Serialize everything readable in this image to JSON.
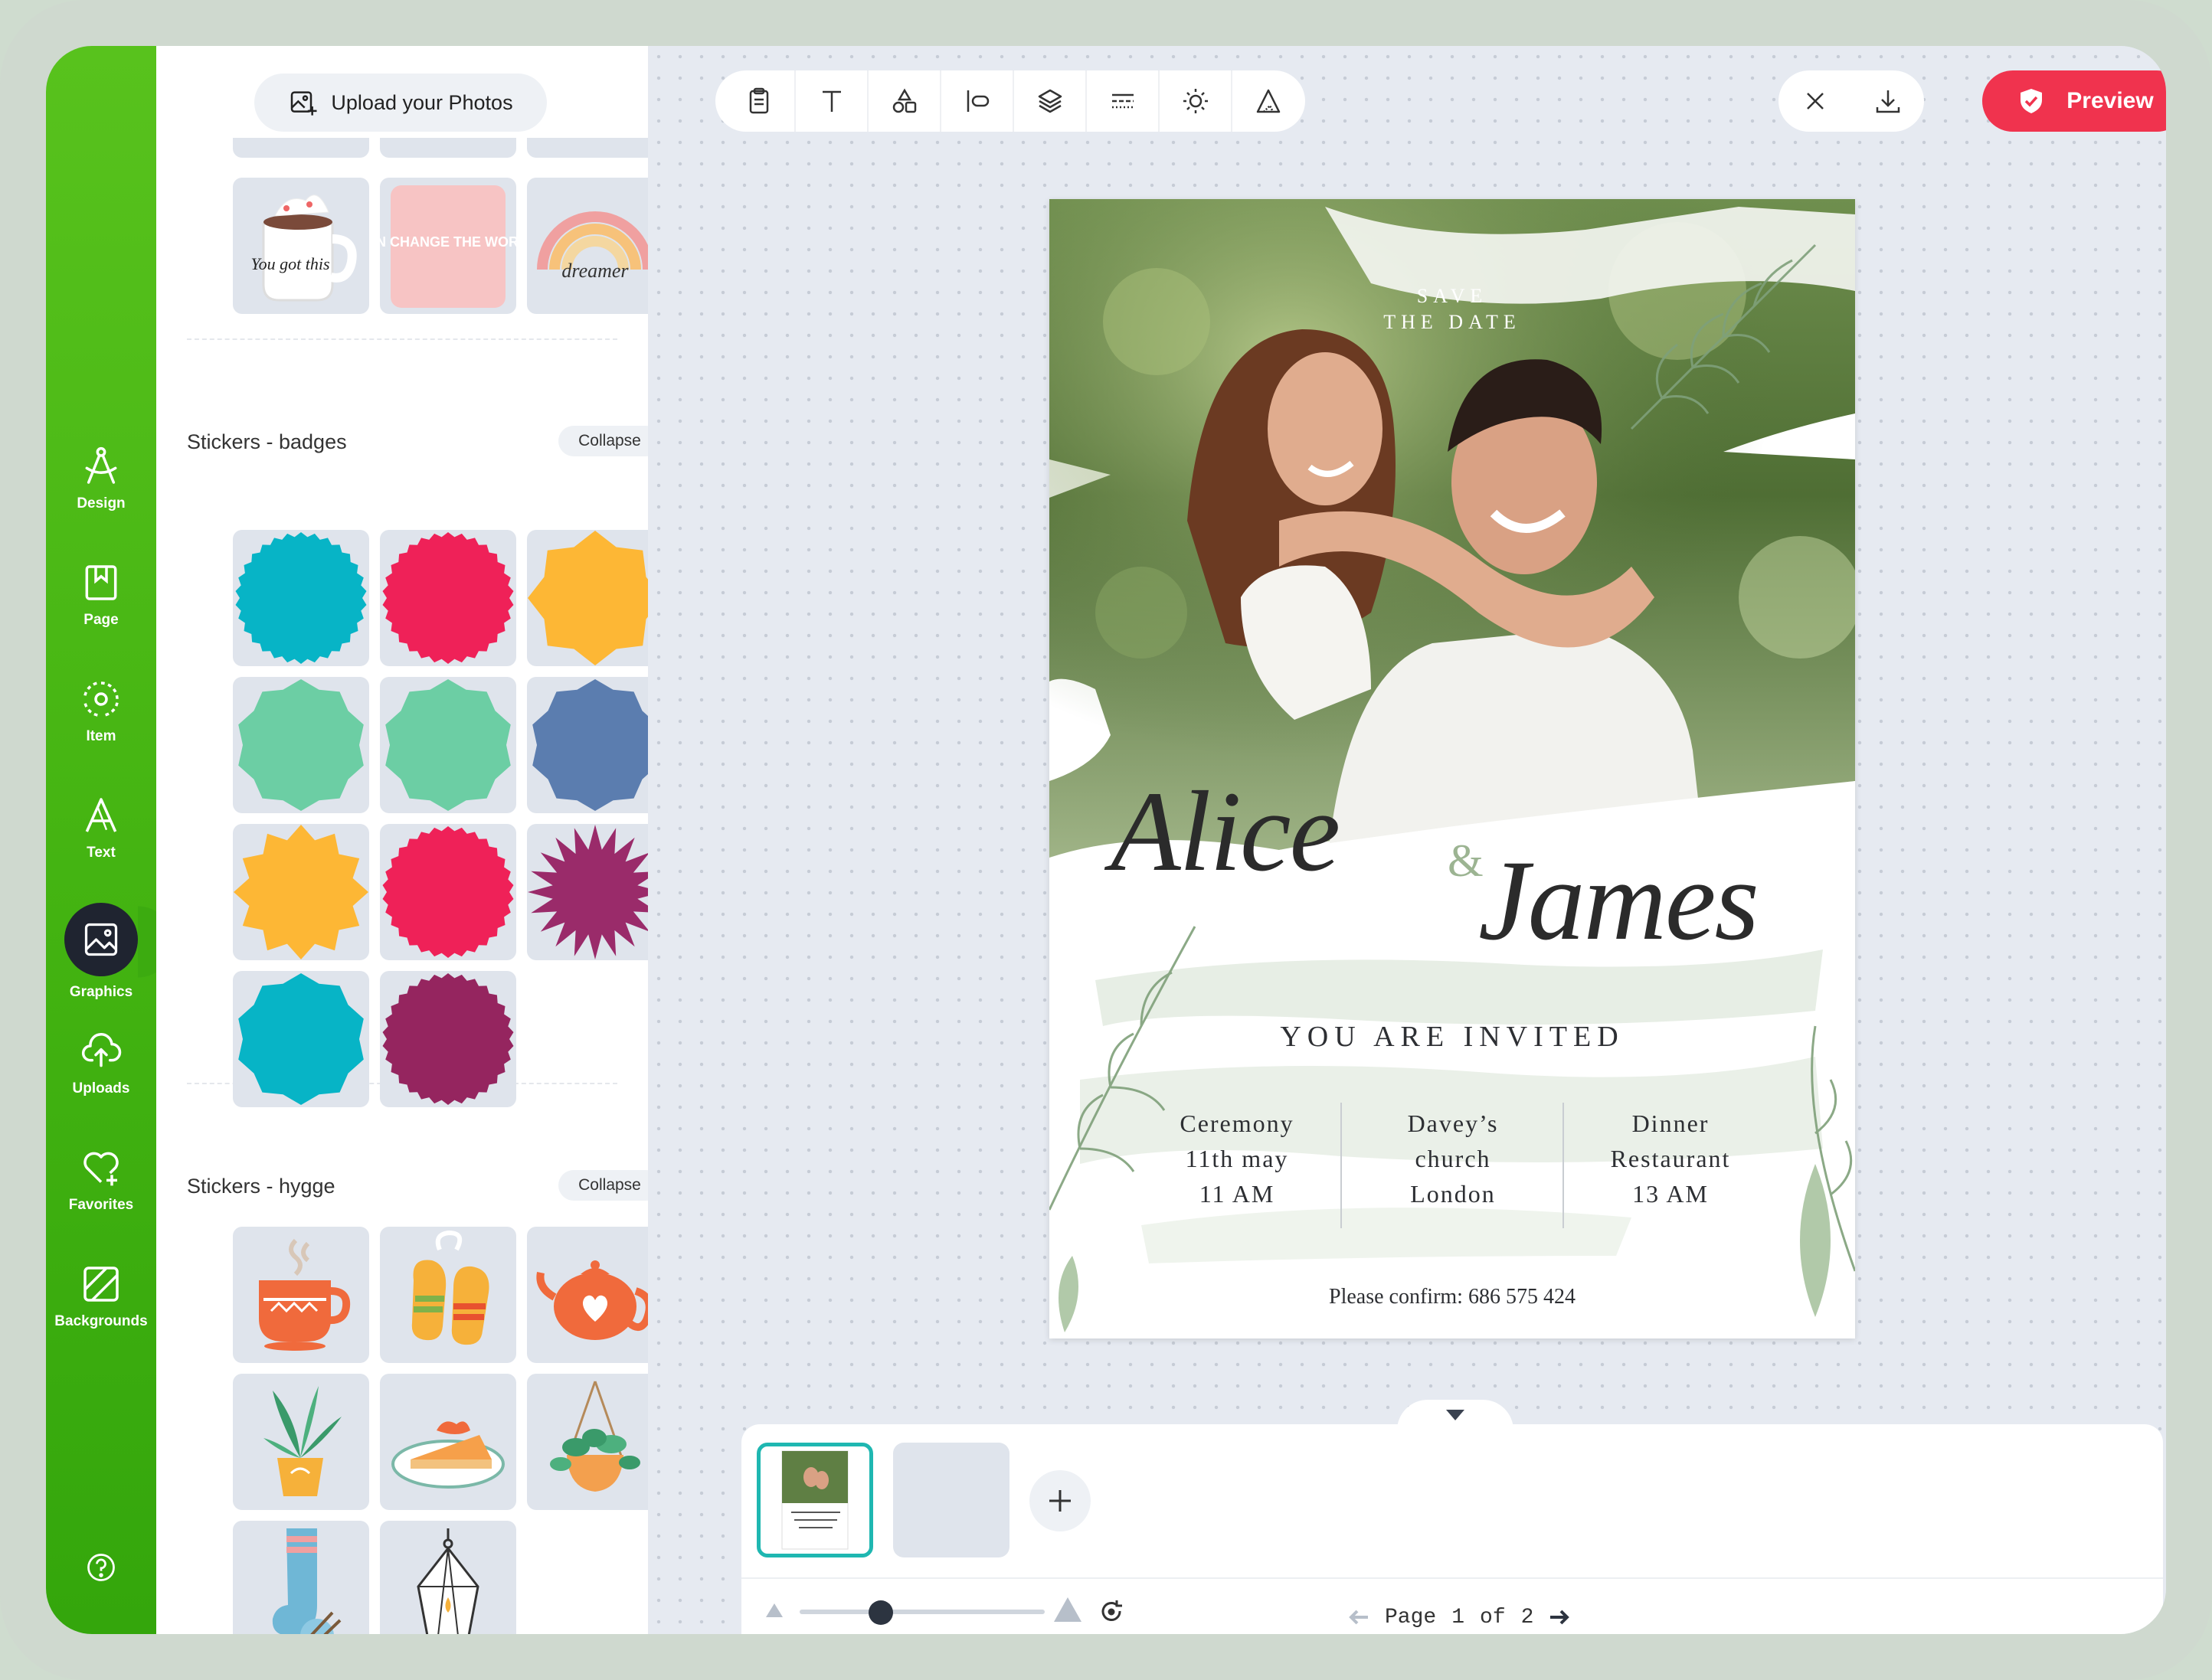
{
  "rail": {
    "items": [
      {
        "label": "Design",
        "icon": "compass-icon"
      },
      {
        "label": "Page",
        "icon": "bookmark-page-icon"
      },
      {
        "label": "Item",
        "icon": "item-target-icon"
      },
      {
        "label": "Text",
        "icon": "text-a-icon"
      },
      {
        "label": "Graphics",
        "icon": "image-icon"
      },
      {
        "label": "Uploads",
        "icon": "cloud-upload-icon"
      },
      {
        "label": "Favorites",
        "icon": "heart-plus-icon"
      },
      {
        "label": "Backgrounds",
        "icon": "backgrounds-icon"
      }
    ],
    "active": "Graphics",
    "colors": {
      "rail": "#43b311",
      "active_bubble": "#1f2430"
    }
  },
  "panel": {
    "upload_label": "Upload your Photos",
    "sections": [
      {
        "title": "Stickers - badges",
        "collapse_label": "Collapse"
      },
      {
        "title": "Stickers - hygge",
        "collapse_label": "Collapse"
      }
    ],
    "top_stickers": [
      {
        "name": "mug-sticker",
        "text": "You got this"
      },
      {
        "name": "change-world-sticker",
        "text": "YOU CAN CHANGE THE WORLD GIRL"
      },
      {
        "name": "dreamer-rainbow-sticker",
        "text": "dreamer"
      }
    ],
    "badge_colors": [
      "#07b4c6",
      "#ef2158",
      "#fdb735",
      "#6ccea4",
      "#6ccea4",
      "#5b7daf",
      "#fdb735",
      "#ef2158",
      "#9a2b6a",
      "#07b4c6",
      "#95255f"
    ],
    "hygge": [
      "coffee-cup-sticker",
      "mittens-sticker",
      "teapot-sticker",
      "plant-pot-sticker",
      "pie-slice-sticker",
      "hanging-plant-sticker",
      "socks-yarn-sticker",
      "lantern-sticker"
    ]
  },
  "toolbar": {
    "tools": [
      "clipboard-icon",
      "text-tool-icon",
      "shapes-icon",
      "align-icon",
      "layers-icon",
      "dash-lines-icon",
      "brightness-icon",
      "triangle-ruler-icon"
    ],
    "preview_label": "Preview",
    "accent": "#f0334e"
  },
  "invitation": {
    "save": "SAVE",
    "the_date": "THE DATE",
    "name1": "Alice",
    "amp": "&",
    "name2": "James",
    "invited": "YOU ARE INVITED",
    "col1": [
      "Ceremony",
      "11th may",
      "11 AM"
    ],
    "col2": [
      "Davey’s",
      "church",
      "London"
    ],
    "col3": [
      "Dinner",
      "Restaurant",
      "13 AM"
    ],
    "confirm": "Please confirm: 686 575 424"
  },
  "pages": {
    "page_label": "Page",
    "current": "1",
    "of_label": "of",
    "total": "2",
    "zoom_fraction": 0.33,
    "selected_color": "#1fb7b1"
  }
}
